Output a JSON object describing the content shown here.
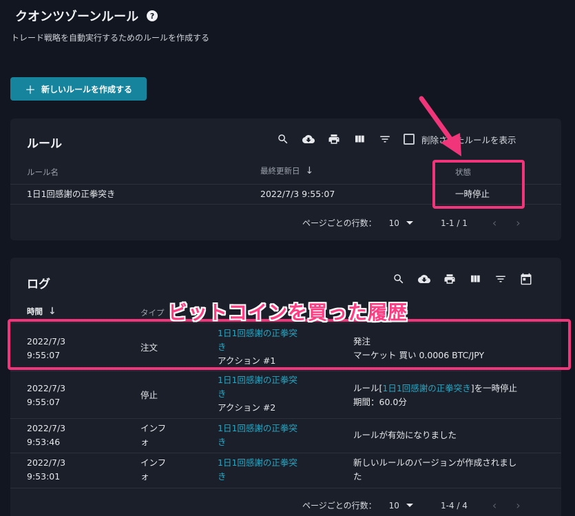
{
  "page": {
    "title": "クオンツゾーンルール",
    "subtitle": "トレード戦略を自動実行するためのルールを作成する",
    "create_button": "新しいルールを作成する",
    "help_glyph": "?"
  },
  "rules_panel": {
    "title": "ルール",
    "show_deleted_label": "削除されたルールを表示",
    "columns": {
      "name": "ルール名",
      "updated": "最終更新日",
      "status": "状態"
    },
    "rows": [
      {
        "name": "1日1回感謝の正拳突き",
        "updated": "2022/7/3 9:55:07",
        "status": "一時停止"
      }
    ],
    "pagination": {
      "label": "ページごとの行数：",
      "rows_per_page": "10",
      "range": "1-1 / 1"
    }
  },
  "logs_panel": {
    "title": "ログ",
    "columns": {
      "time": "時間",
      "type": "タイプ"
    },
    "rows": [
      {
        "date": "2022/7/3",
        "time": "9:55:07",
        "type_line1": "注文",
        "type_line2": "",
        "rule_line1": "1日1回感謝の正拳突",
        "rule_line2": "き",
        "action": "アクション #1",
        "detail_line1": "発注",
        "detail_line2": "マーケット 買い 0.0006 BTC/JPY"
      },
      {
        "date": "2022/7/3",
        "time": "9:55:07",
        "type_line1": "停止",
        "type_line2": "",
        "rule_line1": "1日1回感謝の正拳突",
        "rule_line2": "き",
        "action": "アクション #2",
        "detail_prefix": "ルール[",
        "detail_link": "1日1回感謝の正拳突き",
        "detail_suffix": "]を一時停止",
        "detail_line2": "期間：60.0分"
      },
      {
        "date": "2022/7/3",
        "time": "9:53:46",
        "type_line1": "インフ",
        "type_line2": "ォ",
        "rule_line1": "1日1回感謝の正拳突",
        "rule_line2": "き",
        "action": "",
        "detail_line1": "ルールが有効になりました",
        "detail_line2": ""
      },
      {
        "date": "2022/7/3",
        "time": "9:53:01",
        "type_line1": "インフ",
        "type_line2": "ォ",
        "rule_line1": "1日1回感謝の正拳突",
        "rule_line2": "き",
        "action": "",
        "detail_line1": "新しいルールのバージョンが作成されまし",
        "detail_line2": "た"
      }
    ],
    "pagination": {
      "label": "ページごとの行数：",
      "rows_per_page": "10",
      "range": "1-4 / 4"
    }
  },
  "annotation": {
    "caption": "ビットコインを買った履歴",
    "color": "#f0357a"
  },
  "icons": [
    "search-icon",
    "download-icon",
    "print-icon",
    "columns-icon",
    "filter-icon",
    "calendar-icon",
    "chevron-left-icon",
    "chevron-right-icon",
    "plus-icon",
    "help-icon"
  ]
}
